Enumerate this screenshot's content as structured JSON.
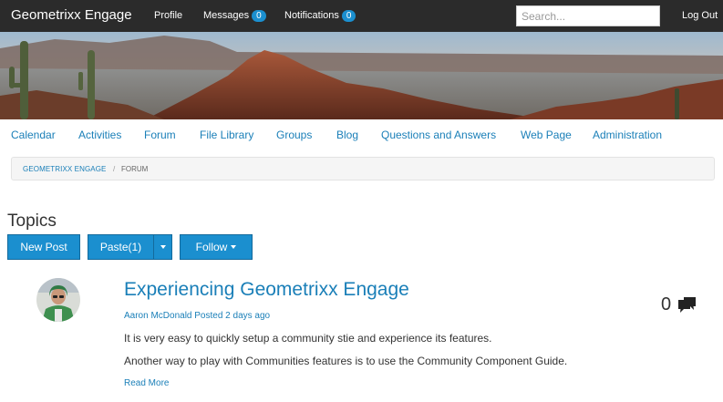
{
  "header": {
    "brand": "Geometrixx Engage",
    "profile_label": "Profile",
    "messages_label": "Messages",
    "messages_count": "0",
    "notifications_label": "Notifications",
    "notifications_count": "0",
    "search_placeholder": "Search...",
    "logout_label": "Log Out"
  },
  "subnav": {
    "items": [
      {
        "label": "Calendar"
      },
      {
        "label": "Activities"
      },
      {
        "label": "Forum"
      },
      {
        "label": "File Library"
      },
      {
        "label": "Groups"
      },
      {
        "label": "Blog"
      },
      {
        "label": "Questions and Answers"
      },
      {
        "label": "Web Page"
      },
      {
        "label": "Administration"
      }
    ]
  },
  "breadcrumb": {
    "home": "GEOMETRIXX ENGAGE",
    "separator": "/",
    "current": "FORUM"
  },
  "topics": {
    "title": "Topics",
    "new_post_label": "New Post",
    "paste_label": "Paste(1)",
    "follow_label": "Follow"
  },
  "post": {
    "title": "Experiencing Geometrixx Engage",
    "meta": "Aaron McDonald Posted 2 days ago",
    "line1": "It is very easy to quickly setup a community stie and experience its features.",
    "line2": "Another way to play with Communities features is to use the Community Component Guide.",
    "read_more": "Read More",
    "reply_count": "0",
    "reply_icon": "comment-icon"
  },
  "colors": {
    "topbar": "#2b2b2b",
    "accent": "#1b8fcf",
    "link": "#1a7fb8"
  }
}
